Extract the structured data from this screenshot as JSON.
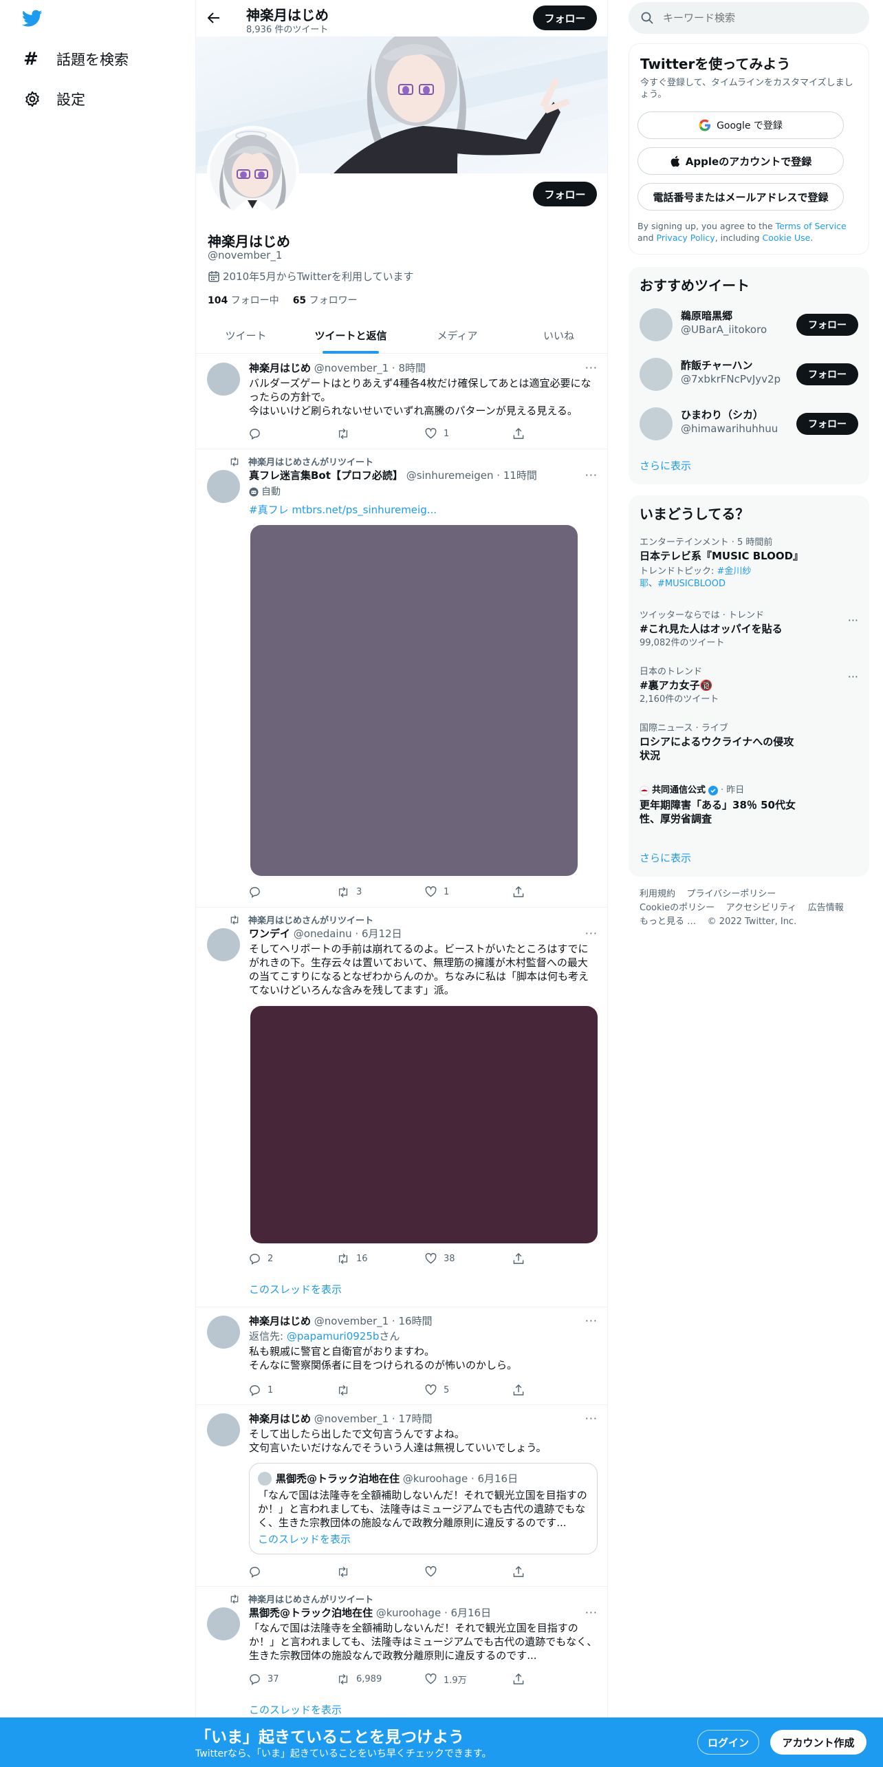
{
  "nav": {
    "explore_label": "話題を検索",
    "settings_label": "設定"
  },
  "header": {
    "name": "神楽月はじめ",
    "tweet_count": "8,936 件のツイート",
    "follow_label": "フォロー"
  },
  "profile": {
    "follow_label": "フォロー",
    "name": "神楽月はじめ",
    "handle": "@november_1",
    "joined": "2010年5月からTwitterを利用しています",
    "following_count": "104",
    "following_label": "フォロー中",
    "followers_count": "65",
    "followers_label": "フォロワー"
  },
  "tabs": [
    "ツイート",
    "ツイートと返信",
    "メディア",
    "いいね"
  ],
  "tweets": [
    {
      "name": "神楽月はじめ",
      "meta": "@november_1 · 8時間",
      "text1": "バルダーズゲートはとりあえず4種各4枚だけ確保してあとは適宜必要になったらの方針で。",
      "text2": "今はいいけど刷られないせいでいずれ高騰のパターンが見える見える。",
      "reply": "",
      "retweet": "",
      "like": "1"
    },
    {
      "retweeted_by": "神楽月はじめさんがリツイート",
      "name": "真フレ迷言集Bot【プロフ必読】",
      "meta": "@sinhuremeigen · 11時間",
      "bot_label": "自動",
      "link_hashtag": "#真フレ",
      "link_url": "mtbrs.net/ps_sinhuremeig...",
      "reply": "",
      "retweet": "3",
      "like": "1",
      "media_color": "#6e6479"
    },
    {
      "retweeted_by": "神楽月はじめさんがリツイート",
      "name": "ワンデイ",
      "meta": "@onedainu · 6月12日",
      "text1": "そしてヘリポートの手前は崩れてるのよ。ビーストがいたところはすでにがれきの下。生存云々は置いておいて、無理筋の擁護が木村監督への最大の当てこすりになるとなぜわからんのか。ちなみに私は「脚本は何も考えてないけどいろんな含みを残してます」派。",
      "reply": "2",
      "retweet": "16",
      "like": "38",
      "media_color": "#47263a",
      "show_thread": "このスレッドを表示"
    },
    {
      "name": "神楽月はじめ",
      "meta": "@november_1 · 16時間",
      "reply_to_prefix": "返信先: ",
      "reply_to_handle": "@papamuri0925b",
      "reply_to_suffix": "さん",
      "text1": "私も親戚に警官と自衛官がおりますわ。",
      "text2": "そんなに警察関係者に目をつけられるのが怖いのかしら。",
      "reply": "1",
      "retweet": "",
      "like": "5"
    },
    {
      "name": "神楽月はじめ",
      "meta": "@november_1 · 17時間",
      "text1": "そして出したら出したで文句言うんですよね。",
      "text2": "文句言いたいだけなんでそういう人達は無視していいでしょう。",
      "quote_name": "黒御禿@トラック泊地在住",
      "quote_meta": "@kuroohage · 6月16日",
      "quote_text": "「なんで国は法隆寺を全額補助しないんだ！それで観光立国を目指すのか！」と言われましても、法隆寺はミュージアムでも古代の遺跡でもなく、生きた宗教団体の施設なんで政教分離原則に違反するのです...",
      "quote_show_thread": "このスレッドを表示",
      "reply": "",
      "retweet": "",
      "like": ""
    },
    {
      "retweeted_by": "神楽月はじめさんがリツイート",
      "name": "黒御禿@トラック泊地在住",
      "meta": "@kuroohage · 6月16日",
      "text1": "「なんで国は法隆寺を全額補助しないんだ！それで観光立国を目指すのか！」と言われましても、法隆寺はミュージアムでも古代の遺跡でもなく、生きた宗教団体の施設なんで政教分離原則に違反するのです...",
      "reply": "37",
      "retweet": "6,989",
      "like": "1.9万",
      "show_thread": "このスレッドを表示"
    }
  ],
  "search": {
    "placeholder": "キーワード検索"
  },
  "signup": {
    "title": "Twitterを使ってみよう",
    "subtitle": "今すぐ登録して、タイムラインをカスタマイズしましょう。",
    "google_label": "Google で登録",
    "apple_label": "Appleのアカウントで登録",
    "phone_label": "電話番号またはメールアドレスで登録",
    "terms_prefix": "By signing up, you agree to the ",
    "terms_link": "Terms of Service",
    "terms_and": " and ",
    "privacy_link": "Privacy Policy",
    "terms_including": ", including ",
    "cookie_link": "Cookie Use",
    "terms_end": "."
  },
  "who_to_follow": {
    "title": "おすすめツイート",
    "users": [
      {
        "name": "鵜原暗黒郷",
        "handle": "@UBarA_iitokoro"
      },
      {
        "name": "酢飯チャーハン",
        "handle": "@7xbkrFNcPvJyv2p"
      },
      {
        "name": "ひまわり（シカ）",
        "handle": "@himawarihuhhuu"
      }
    ],
    "follow_label": "フォロー",
    "show_more": "さらに表示"
  },
  "trends": {
    "title": "いまどうしてる？",
    "items": [
      {
        "meta": "エンターテインメント · 5 時間前",
        "title": "日本テレビ系『MUSIC BLOOD』",
        "sub_prefix": "トレンドトピック: ",
        "sub_link1": "#金川紗耶",
        "sub_sep": "、",
        "sub_link2": "#MUSICBLOOD"
      },
      {
        "meta": "ツイッターならでは · トレンド",
        "title": "#これ見た人はオッパイを貼る",
        "sub": "99,082件のツイート"
      },
      {
        "meta": "日本のトレンド",
        "title": "#裏アカ女子🔞",
        "sub": "2,160件のツイート"
      },
      {
        "meta": "国際ニュース · ライブ",
        "title": "ロシアによるウクライナへの侵攻状況"
      },
      {
        "source": "共同通信公式",
        "time": " · 昨日",
        "title": "更年期障害「ある」38％ 50代女性、厚労省調査"
      }
    ],
    "show_more": "さらに表示"
  },
  "footer": {
    "links": [
      "利用規約",
      "プライバシーポリシー",
      "Cookieのポリシー",
      "アクセシビリティ",
      "広告情報",
      "もっと見る …"
    ],
    "copyright": "© 2022 Twitter, Inc."
  },
  "bottom_bar": {
    "title": "「いま」起きていることを見つけよう",
    "subtitle": "Twitterなら、「いま」起きていることをいち早くチェックできます。",
    "login_label": "ログイン",
    "signup_label": "アカウント作成"
  },
  "colors": {
    "accent": "#1d9bf0",
    "text": "#0f1419",
    "secondary": "#536471"
  }
}
